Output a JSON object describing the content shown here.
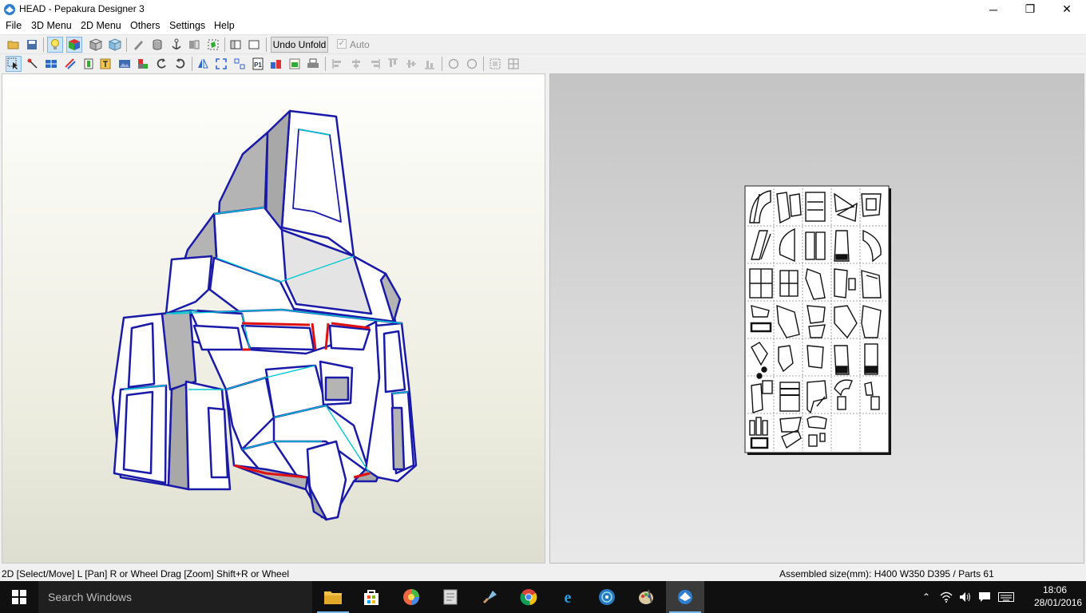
{
  "window": {
    "title": "HEAD - Pepakura Designer 3"
  },
  "menu": [
    "File",
    "3D Menu",
    "2D Menu",
    "Others",
    "Settings",
    "Help"
  ],
  "toolbar": {
    "undo_unfold": "Undo Unfold",
    "auto_label": "Auto",
    "auto_checked": true
  },
  "status": {
    "left": "2D [Select/Move] L [Pan] R or Wheel Drag [Zoom] Shift+R or Wheel",
    "right": "Assembled size(mm): H400 W350 D395 / Parts 61"
  },
  "taskbar": {
    "search_placeholder": "Search Windows",
    "time": "18:06",
    "date": "28/01/2016"
  },
  "colors": {
    "edge": "#1a1aa8",
    "fold": "#00c8d2",
    "cut": "#e01010",
    "face": "#ffffff",
    "shade": "#b4b4b4"
  }
}
